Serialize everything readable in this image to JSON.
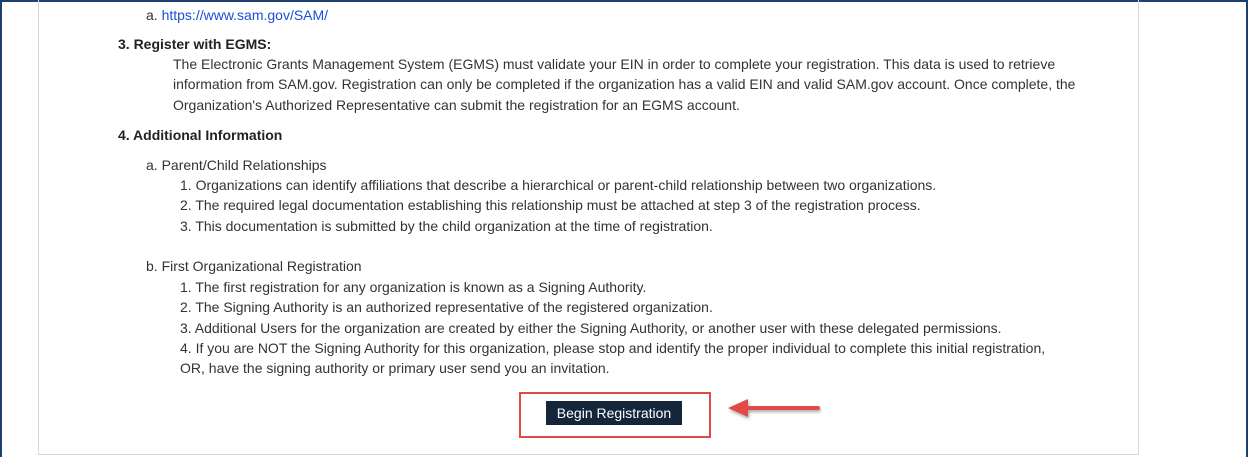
{
  "sam_link": {
    "prefix": "a.",
    "url": "https://www.sam.gov/SAM/"
  },
  "section3": {
    "heading": "3. Register with EGMS:",
    "lines": [
      "The Electronic Grants Management System (EGMS) must validate your EIN in order to complete your registration. This data is used to retrieve",
      "information from SAM.gov. Registration can only be completed if the organization has a valid EIN and valid SAM.gov account. Once complete, the",
      "Organization's Authorized Representative can submit the registration for an EGMS account."
    ]
  },
  "section4": {
    "heading": "4. Additional Information",
    "subsection_a": {
      "title": "a. Parent/Child Relationships",
      "items": [
        "1. Organizations can identify affiliations that describe a hierarchical or parent-child relationship between two organizations.",
        "2. The required legal documentation establishing this relationship must be attached at step 3 of the registration process.",
        "3. This documentation is submitted by the child organization at the time of registration."
      ]
    },
    "subsection_b": {
      "title": "b. First Organizational Registration",
      "items": [
        "1. The first registration for any organization is known as a Signing Authority.",
        "2. The Signing Authority is an authorized representative of the registered organization.",
        "3. Additional Users for the organization are created by either the Signing Authority, or another user with these delegated permissions.",
        "4. If you are NOT the Signing Authority for this organization, please stop and identify the proper individual to complete this initial registration,",
        "OR, have the signing authority or primary user send you an invitation."
      ]
    }
  },
  "begin_button": {
    "label": "Begin Registration"
  },
  "colors": {
    "button_bg": "#14263a",
    "highlight": "#e24a4a",
    "link": "#1a4fd6",
    "frame": "#1f3f6e"
  },
  "icons": {
    "annotation_arrow": "red-left-arrow-icon"
  }
}
